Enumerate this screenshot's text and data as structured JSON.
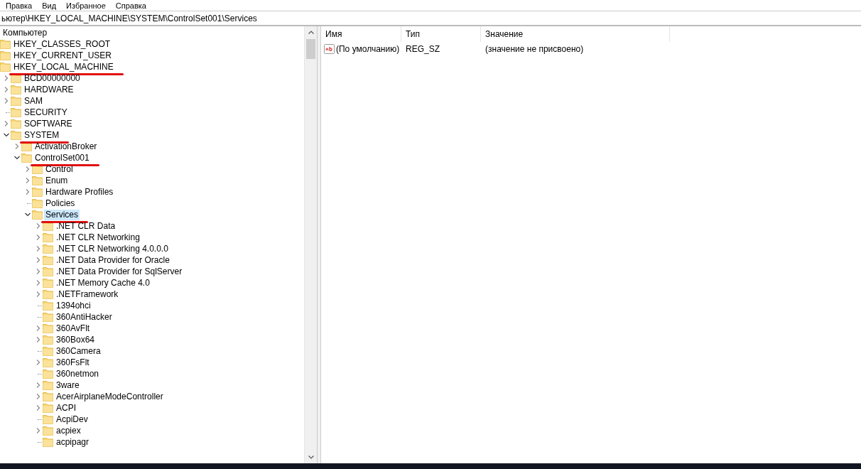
{
  "menu": [
    "Правка",
    "Вид",
    "Избранное",
    "Справка"
  ],
  "address": "ьютер\\HKEY_LOCAL_MACHINE\\SYSTEM\\ControlSet001\\Services",
  "tree": {
    "label": "Компьютер",
    "children": [
      {
        "label": "HKEY_CLASSES_ROOT",
        "kind": "root",
        "selected": false,
        "underlined": false
      },
      {
        "label": "HKEY_CURRENT_USER",
        "kind": "root",
        "selected": false,
        "underlined": false
      },
      {
        "label": "HKEY_LOCAL_MACHINE",
        "kind": "root",
        "selected": false,
        "underlined": true,
        "children": [
          {
            "label": "BCD00000000",
            "kind": "branch",
            "expanded": false,
            "selected": false,
            "underlined": false
          },
          {
            "label": "HARDWARE",
            "kind": "branch",
            "expanded": false,
            "selected": false,
            "underlined": false
          },
          {
            "label": "SAM",
            "kind": "branch",
            "expanded": false,
            "selected": false,
            "underlined": false
          },
          {
            "label": "SECURITY",
            "kind": "leaf",
            "selected": false,
            "underlined": false
          },
          {
            "label": "SOFTWARE",
            "kind": "branch",
            "expanded": false,
            "selected": false,
            "underlined": false
          },
          {
            "label": "SYSTEM",
            "kind": "branch",
            "expanded": true,
            "selected": false,
            "underlined": true,
            "children": [
              {
                "label": "ActivationBroker",
                "kind": "branch",
                "expanded": false,
                "selected": false,
                "underlined": false
              },
              {
                "label": "ControlSet001",
                "kind": "branch",
                "expanded": true,
                "selected": false,
                "underlined": true,
                "children": [
                  {
                    "label": "Control",
                    "kind": "branch",
                    "expanded": false,
                    "selected": false,
                    "underlined": false
                  },
                  {
                    "label": "Enum",
                    "kind": "branch",
                    "expanded": false,
                    "selected": false,
                    "underlined": false
                  },
                  {
                    "label": "Hardware Profiles",
                    "kind": "branch",
                    "expanded": false,
                    "selected": false,
                    "underlined": false
                  },
                  {
                    "label": "Policies",
                    "kind": "leaf",
                    "selected": false,
                    "underlined": false
                  },
                  {
                    "label": "Services",
                    "kind": "branch",
                    "expanded": true,
                    "selected": true,
                    "underlined": true,
                    "children": [
                      {
                        "label": ".NET CLR Data",
                        "kind": "branch",
                        "expanded": false,
                        "selected": false,
                        "underlined": false
                      },
                      {
                        "label": ".NET CLR Networking",
                        "kind": "branch",
                        "expanded": false,
                        "selected": false,
                        "underlined": false
                      },
                      {
                        "label": ".NET CLR Networking 4.0.0.0",
                        "kind": "branch",
                        "expanded": false,
                        "selected": false,
                        "underlined": false
                      },
                      {
                        "label": ".NET Data Provider for Oracle",
                        "kind": "branch",
                        "expanded": false,
                        "selected": false,
                        "underlined": false
                      },
                      {
                        "label": ".NET Data Provider for SqlServer",
                        "kind": "branch",
                        "expanded": false,
                        "selected": false,
                        "underlined": false
                      },
                      {
                        "label": ".NET Memory Cache 4.0",
                        "kind": "branch",
                        "expanded": false,
                        "selected": false,
                        "underlined": false
                      },
                      {
                        "label": ".NETFramework",
                        "kind": "branch",
                        "expanded": false,
                        "selected": false,
                        "underlined": false
                      },
                      {
                        "label": "1394ohci",
                        "kind": "leaf",
                        "selected": false,
                        "underlined": false
                      },
                      {
                        "label": "360AntiHacker",
                        "kind": "leaf",
                        "selected": false,
                        "underlined": false
                      },
                      {
                        "label": "360AvFlt",
                        "kind": "branch",
                        "expanded": false,
                        "selected": false,
                        "underlined": false
                      },
                      {
                        "label": "360Box64",
                        "kind": "branch",
                        "expanded": false,
                        "selected": false,
                        "underlined": false
                      },
                      {
                        "label": "360Camera",
                        "kind": "leaf",
                        "selected": false,
                        "underlined": false
                      },
                      {
                        "label": "360FsFlt",
                        "kind": "branch",
                        "expanded": false,
                        "selected": false,
                        "underlined": false
                      },
                      {
                        "label": "360netmon",
                        "kind": "leaf",
                        "selected": false,
                        "underlined": false
                      },
                      {
                        "label": "3ware",
                        "kind": "branch",
                        "expanded": false,
                        "selected": false,
                        "underlined": false
                      },
                      {
                        "label": "AcerAirplaneModeController",
                        "kind": "branch",
                        "expanded": false,
                        "selected": false,
                        "underlined": false
                      },
                      {
                        "label": "ACPI",
                        "kind": "branch",
                        "expanded": false,
                        "selected": false,
                        "underlined": false
                      },
                      {
                        "label": "AcpiDev",
                        "kind": "leaf",
                        "selected": false,
                        "underlined": false
                      },
                      {
                        "label": "acpiex",
                        "kind": "branch",
                        "expanded": false,
                        "selected": false,
                        "underlined": false
                      },
                      {
                        "label": "acpipagr",
                        "kind": "leaf",
                        "selected": false,
                        "underlined": false
                      }
                    ]
                  }
                ]
              }
            ]
          }
        ]
      }
    ]
  },
  "values": {
    "columns": [
      "Имя",
      "Тип",
      "Значение"
    ],
    "rows": [
      {
        "name": "(По умолчанию)",
        "type": "REG_SZ",
        "data": "(значение не присвоено)"
      }
    ]
  }
}
